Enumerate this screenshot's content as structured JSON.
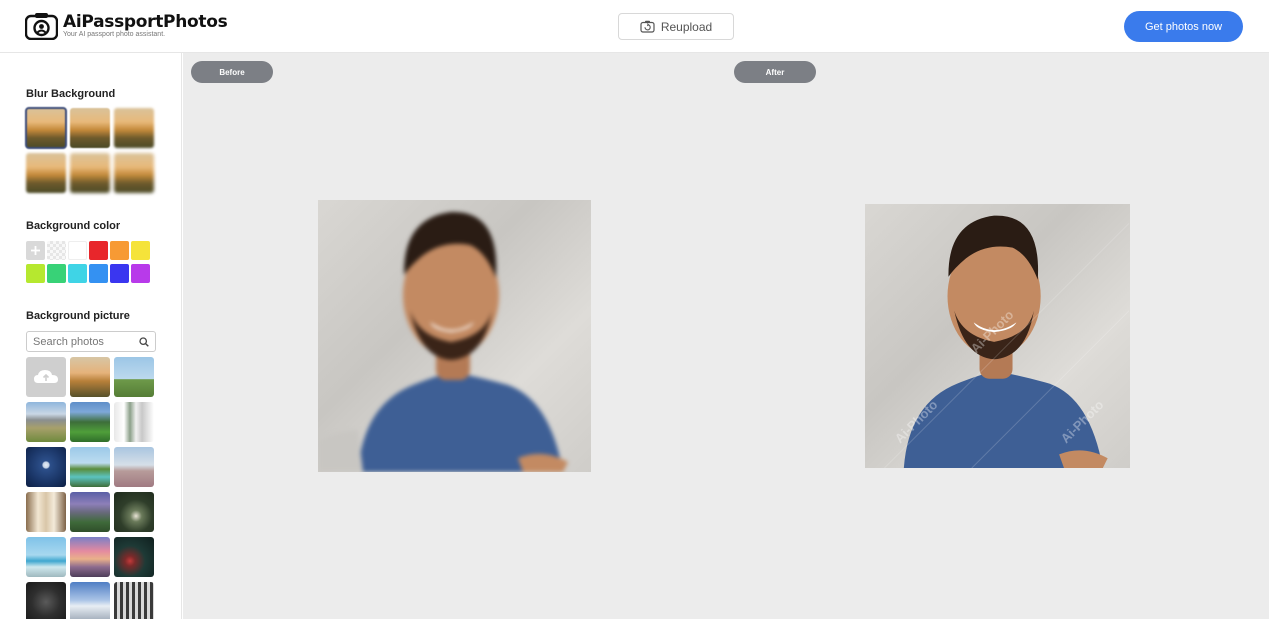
{
  "header": {
    "brand": "AiPassportPhotos",
    "tagline": "Your AI passport photo assistant.",
    "reupload_label": "Reupload",
    "cta_label": "Get photos now"
  },
  "sidebar": {
    "blur_title": "Blur Background",
    "color_title": "Background color",
    "picture_title": "Background picture",
    "search_placeholder": "Search photos",
    "colors": [
      "#d9d9d9",
      "transparent",
      "#ffffff",
      "#e8262b",
      "#f79a34",
      "#f5e33a",
      "#b6e82f",
      "#38d277",
      "#3fd4e6",
      "#3491f2",
      "#3a36f0",
      "#b83aea"
    ]
  },
  "main": {
    "before_label": "Before",
    "after_label": "After",
    "watermark": "Ai-Photo"
  }
}
